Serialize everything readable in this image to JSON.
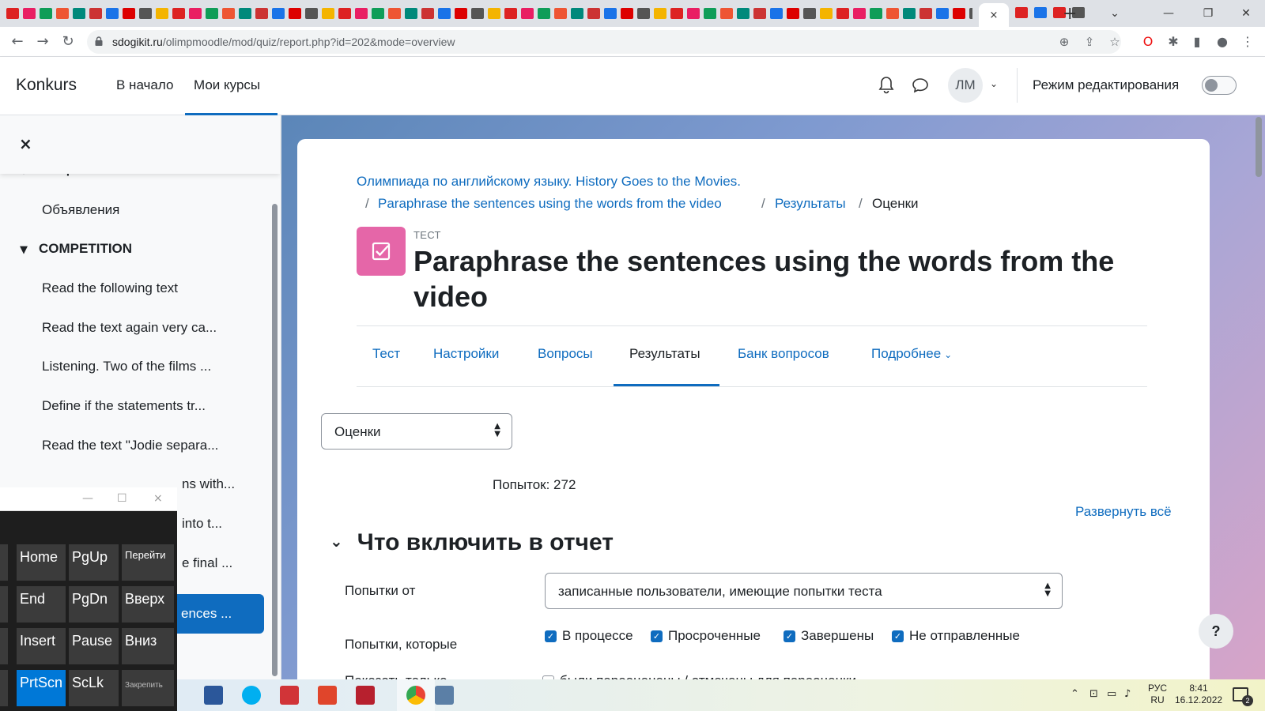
{
  "browser": {
    "active_tab_close": "×",
    "new_tab": "+",
    "url_host": "sdogikit.ru",
    "url_path": "/olimpmoodle/mod/quiz/report.php?id=202&mode=overview"
  },
  "navbar": {
    "brand": "Konkurs",
    "links": [
      "В начало",
      "Мои курсы"
    ],
    "avatar_initials": "ЛМ",
    "edit_mode_label": "Режим редактирования",
    "edit_mode_on": false
  },
  "drawer": {
    "close": "×",
    "top_section_partial": "Общее",
    "general_items": [
      "Объявления"
    ],
    "section": "COMPETITION",
    "items": [
      "Read the following text",
      "Read the text again very ca...",
      "Listening. Two of the films ...",
      "Define if the statements tr...",
      "Read the text \"Jodie separa...",
      "ns with...",
      "into t...",
      "e final ..."
    ],
    "active_item": "ences ..."
  },
  "breadcrumb": {
    "course": "Олимпиада по английскому языку. History Goes to the Movies.",
    "sep": "/",
    "activity": "Paraphrase the sentences using the words from the video",
    "results": "Результаты",
    "current": "Оценки"
  },
  "activity": {
    "type_label": "ТЕСТ",
    "title": "Paraphrase the sentences using the words from the video"
  },
  "tabs": [
    {
      "label": "Тест"
    },
    {
      "label": "Настройки"
    },
    {
      "label": "Вопросы"
    },
    {
      "label": "Результаты",
      "active": true
    },
    {
      "label": "Банк вопросов"
    },
    {
      "label": "Подробнее"
    }
  ],
  "report": {
    "report_select": "Оценки",
    "attempts_text": "Попыток: 272",
    "expand_all": "Развернуть всё",
    "section_title": "Что включить в отчет",
    "attempts_from_label": "Попытки от",
    "attempts_from_value": "записанные пользователи, имеющие попытки теста",
    "attempts_that_label": "Попытки, которые",
    "states": [
      {
        "label": "В процессе",
        "checked": true
      },
      {
        "label": "Просроченные",
        "checked": true
      },
      {
        "label": "Завершены",
        "checked": true
      },
      {
        "label": "Не отправленные",
        "checked": true
      }
    ],
    "show_only_label": "Показать только",
    "regraded_label": "были переоценены / отмечены для переоценки",
    "help": "?"
  },
  "osk": {
    "minimize": "—",
    "maximize": "☐",
    "close": "×",
    "keys": {
      "home": "Home",
      "pgup": "PgUp",
      "goto": "Перейти",
      "end": "End",
      "pgdn": "PgDn",
      "up": "Вверх",
      "insert": "Insert",
      "pause": "Pause",
      "down": "Вниз",
      "prtscn": "PrtScn",
      "sclk": "ScLk",
      "pin": "Закрепить"
    }
  },
  "taskbar": {
    "lang_top": "РУС",
    "lang_bottom": "RU",
    "time": "8:41",
    "date": "16.12.2022",
    "notif_count": "2"
  }
}
